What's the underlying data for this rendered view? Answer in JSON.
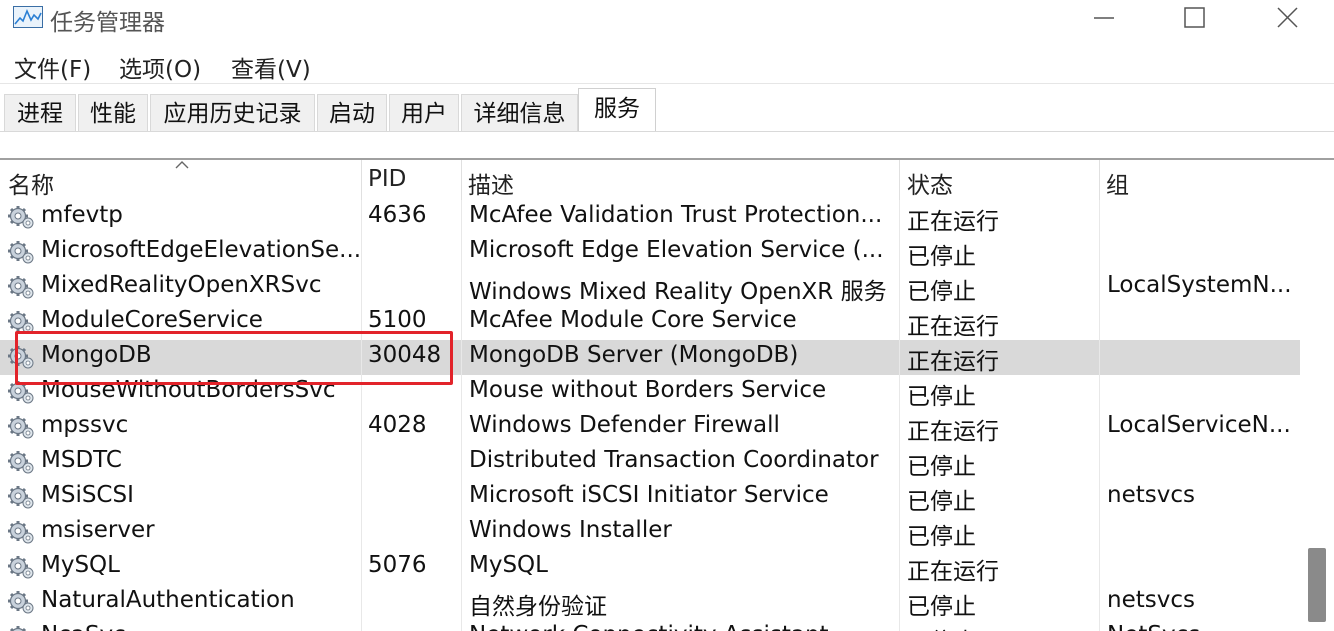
{
  "window": {
    "title": "任务管理器",
    "icon": "task-manager-icon"
  },
  "menu": {
    "items": [
      "文件(F)",
      "选项(O)",
      "查看(V)"
    ]
  },
  "tabs": {
    "items": [
      "进程",
      "性能",
      "应用历史记录",
      "启动",
      "用户",
      "详细信息",
      "服务"
    ],
    "active": "服务"
  },
  "table": {
    "columns": {
      "name": "名称",
      "pid": "PID",
      "description": "描述",
      "status": "状态",
      "group": "组"
    },
    "sorted_by": "名称",
    "selected_service": "MongoDB",
    "rows": [
      {
        "name": "mfevtp",
        "pid": "4636",
        "description": "McAfee Validation Trust Protection...",
        "status": "正在运行",
        "group": ""
      },
      {
        "name": "MicrosoftEdgeElevationSe...",
        "pid": "",
        "description": "Microsoft Edge Elevation Service (...",
        "status": "已停止",
        "group": ""
      },
      {
        "name": "MixedRealityOpenXRSvc",
        "pid": "",
        "description": "Windows Mixed Reality OpenXR 服务",
        "status": "已停止",
        "group": "LocalSystemN..."
      },
      {
        "name": "ModuleCoreService",
        "pid": "5100",
        "description": "McAfee Module Core Service",
        "status": "正在运行",
        "group": ""
      },
      {
        "name": "MongoDB",
        "pid": "30048",
        "description": "MongoDB Server (MongoDB)",
        "status": "正在运行",
        "group": ""
      },
      {
        "name": "MouseWithoutBordersSvc",
        "pid": "",
        "description": "Mouse without Borders Service",
        "status": "已停止",
        "group": ""
      },
      {
        "name": "mpssvc",
        "pid": "4028",
        "description": "Windows Defender Firewall",
        "status": "正在运行",
        "group": "LocalServiceN..."
      },
      {
        "name": "MSDTC",
        "pid": "",
        "description": "Distributed Transaction Coordinator",
        "status": "已停止",
        "group": ""
      },
      {
        "name": "MSiSCSI",
        "pid": "",
        "description": "Microsoft iSCSI Initiator Service",
        "status": "已停止",
        "group": "netsvcs"
      },
      {
        "name": "msiserver",
        "pid": "",
        "description": "Windows Installer",
        "status": "已停止",
        "group": ""
      },
      {
        "name": "MySQL",
        "pid": "5076",
        "description": "MySQL",
        "status": "正在运行",
        "group": ""
      },
      {
        "name": "NaturalAuthentication",
        "pid": "",
        "description": "自然身份验证",
        "status": "已停止",
        "group": "netsvcs"
      },
      {
        "name": "NcaSvc",
        "pid": "",
        "description": "Network Connectivity Assistant",
        "status": "已停止",
        "group": "NetSvcs"
      }
    ]
  },
  "colors": {
    "highlight": "#e2232a",
    "selected_row": "#d9d9d9",
    "scroll_thumb": "#8a8a8a"
  }
}
